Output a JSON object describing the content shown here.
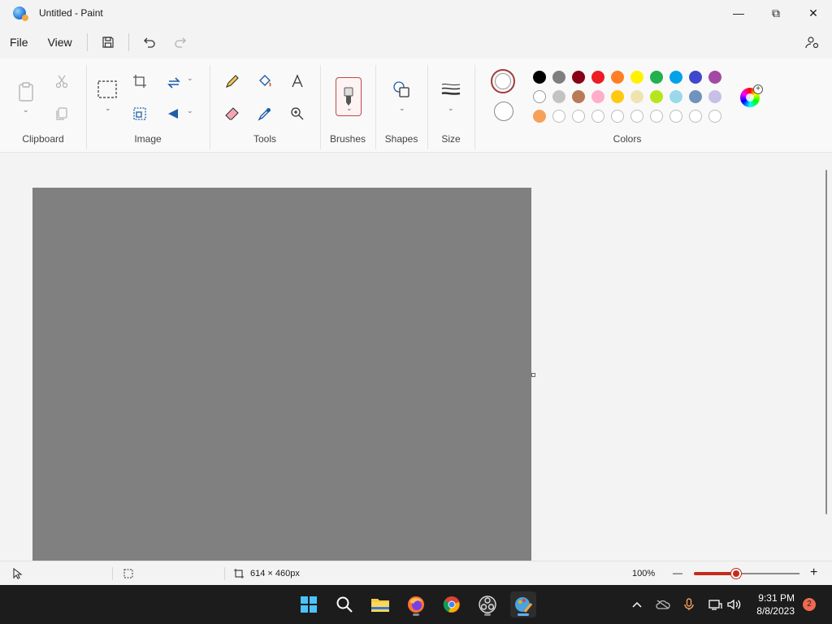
{
  "window": {
    "title": "Untitled - Paint",
    "minimize": "—",
    "restore": "⧉",
    "close": "✕"
  },
  "menu": {
    "file": "File",
    "view": "View"
  },
  "ribbon": {
    "clipboard_label": "Clipboard",
    "image_label": "Image",
    "tools_label": "Tools",
    "brushes_label": "Brushes",
    "shapes_label": "Shapes",
    "size_label": "Size",
    "colors_label": "Colors"
  },
  "colors": {
    "color1": "#ffffff",
    "color1_ring": "#a33b3b",
    "color2": "#ffffff",
    "palette_row1": [
      "#000000",
      "#7f7f7f",
      "#880015",
      "#ed1c24",
      "#ff7f27",
      "#fff200",
      "#22b14c",
      "#00a2e8",
      "#3f48cc",
      "#a349a4"
    ],
    "palette_row2": [
      "#ffffff",
      "#c3c3c3",
      "#b97a57",
      "#ffaec9",
      "#ffc90e",
      "#efe4b0",
      "#b5e61d",
      "#99d9ea",
      "#7092be",
      "#c8bfe7"
    ],
    "palette_row3": [
      "#f7a05a",
      "",
      "",
      "",
      "",
      "",
      "",
      "",
      "",
      ""
    ]
  },
  "canvas": {
    "background": "#808080"
  },
  "status": {
    "canvas_size": "614 × 460px",
    "zoom": "100%",
    "zoom_minus": "—",
    "zoom_plus": "+"
  },
  "taskbar": {
    "time": "9:31 PM",
    "date": "8/8/2023",
    "notification_count": "2",
    "apps": [
      "start-icon",
      "search-icon",
      "file-explorer-icon",
      "firefox-icon",
      "chrome-icon",
      "obs-icon",
      "paint-icon"
    ]
  }
}
